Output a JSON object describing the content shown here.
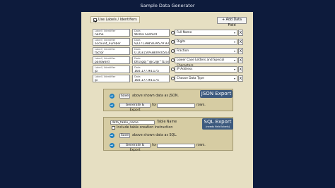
{
  "app": {
    "title": "Sample Data Generator"
  },
  "toolbar": {
    "use_labels_label": "Use Labels / Identifiers",
    "use_labels_checked": true,
    "add_field_label": "+ Add Data Field"
  },
  "fields": [
    {
      "label_caption": "Label / Identifier",
      "label_value": "name",
      "data_caption": "Data",
      "data_value": "Wilma Sanford",
      "type": "Full Name"
    },
    {
      "label_caption": "Label / Identifier",
      "label_value": "account_number",
      "data_caption": "Data",
      "data_value": "922713985839579 93",
      "type": "Digits"
    },
    {
      "label_caption": "Label / Identifier",
      "label_value": "factor",
      "data_caption": "Data",
      "data_value": "0.20315093800405437",
      "type": "Fraction"
    },
    {
      "label_caption": "Label / Identifier",
      "label_value": "password",
      "data_caption": "Data",
      "data_value": "bfl1[gq]^@c2@^t1[x@&",
      "type": "Lower Case Letters and Special Characters"
    },
    {
      "label_caption": "Label / Identifier",
      "label_value": "ip",
      "data_caption": "Data",
      "data_value": "160.177.94.175",
      "type": "IP Address"
    },
    {
      "label_caption": "Label / Identifier",
      "label_value": "ip",
      "data_caption": "Data",
      "data_value": "160.177.94.175",
      "type": "Choose Data Type"
    }
  ],
  "delete_label": "X",
  "json_export": {
    "badge": "JSON Export",
    "save_label": "Save",
    "save_text": "above shown data as JSON.",
    "generate_label": "Generate & Export",
    "for_text": "for",
    "rows_value": "",
    "rows_text": "rows."
  },
  "sql_export": {
    "badge": "SQL Export",
    "badge_sub": "(needs field labels)",
    "table_name_value": "data_table_name",
    "table_name_text": "Table Name",
    "include_creation_label": "Include table creation instruction",
    "include_creation_checked": false,
    "save_label": "Save",
    "save_text": "above shown data as SQL.",
    "generate_label": "Generate & Export",
    "for_text": "for",
    "rows_value": "",
    "rows_text": "rows."
  }
}
